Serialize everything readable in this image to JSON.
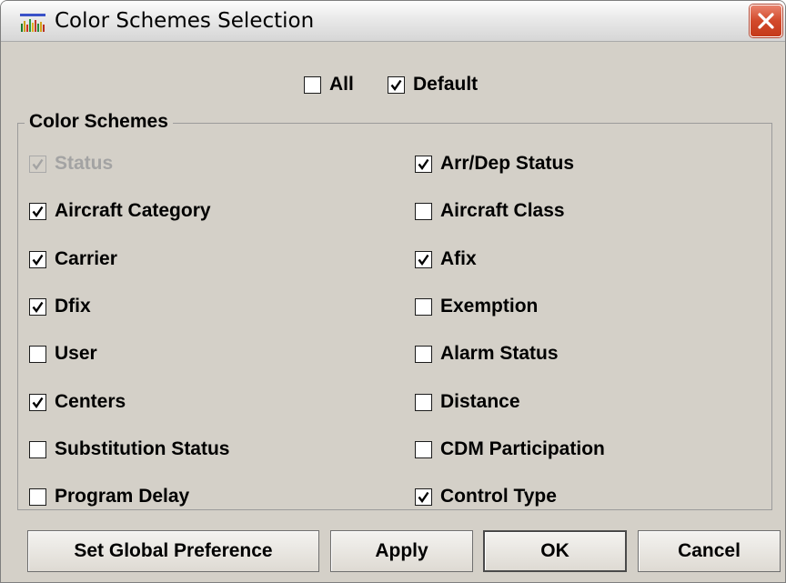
{
  "window": {
    "title": "Color Schemes Selection",
    "app_icon": "bar-chart-icon",
    "close_icon": "close-icon"
  },
  "filters": {
    "all": {
      "label": "All",
      "checked": false
    },
    "default": {
      "label": "Default",
      "checked": true
    }
  },
  "group": {
    "label": "Color Schemes",
    "left_column": [
      {
        "label": "Status",
        "checked": true,
        "disabled": true
      },
      {
        "label": "Aircraft Category",
        "checked": true,
        "disabled": false
      },
      {
        "label": "Carrier",
        "checked": true,
        "disabled": false
      },
      {
        "label": "Dfix",
        "checked": true,
        "disabled": false
      },
      {
        "label": "User",
        "checked": false,
        "disabled": false
      },
      {
        "label": "Centers",
        "checked": true,
        "disabled": false
      },
      {
        "label": "Substitution Status",
        "checked": false,
        "disabled": false
      },
      {
        "label": "Program Delay",
        "checked": false,
        "disabled": false
      }
    ],
    "right_column": [
      {
        "label": "Arr/Dep Status",
        "checked": true,
        "disabled": false
      },
      {
        "label": "Aircraft Class",
        "checked": false,
        "disabled": false
      },
      {
        "label": "Afix",
        "checked": true,
        "disabled": false
      },
      {
        "label": "Exemption",
        "checked": false,
        "disabled": false
      },
      {
        "label": "Alarm Status",
        "checked": false,
        "disabled": false
      },
      {
        "label": "Distance",
        "checked": false,
        "disabled": false
      },
      {
        "label": "CDM Participation",
        "checked": false,
        "disabled": false
      },
      {
        "label": "Control Type",
        "checked": true,
        "disabled": false
      }
    ]
  },
  "buttons": {
    "set_global": "Set Global Preference",
    "apply": "Apply",
    "ok": "OK",
    "cancel": "Cancel"
  },
  "colors": {
    "dialog_bg": "#d4d0c8",
    "disabled_text": "#a3a3a3",
    "close_red": "#d2492b"
  }
}
